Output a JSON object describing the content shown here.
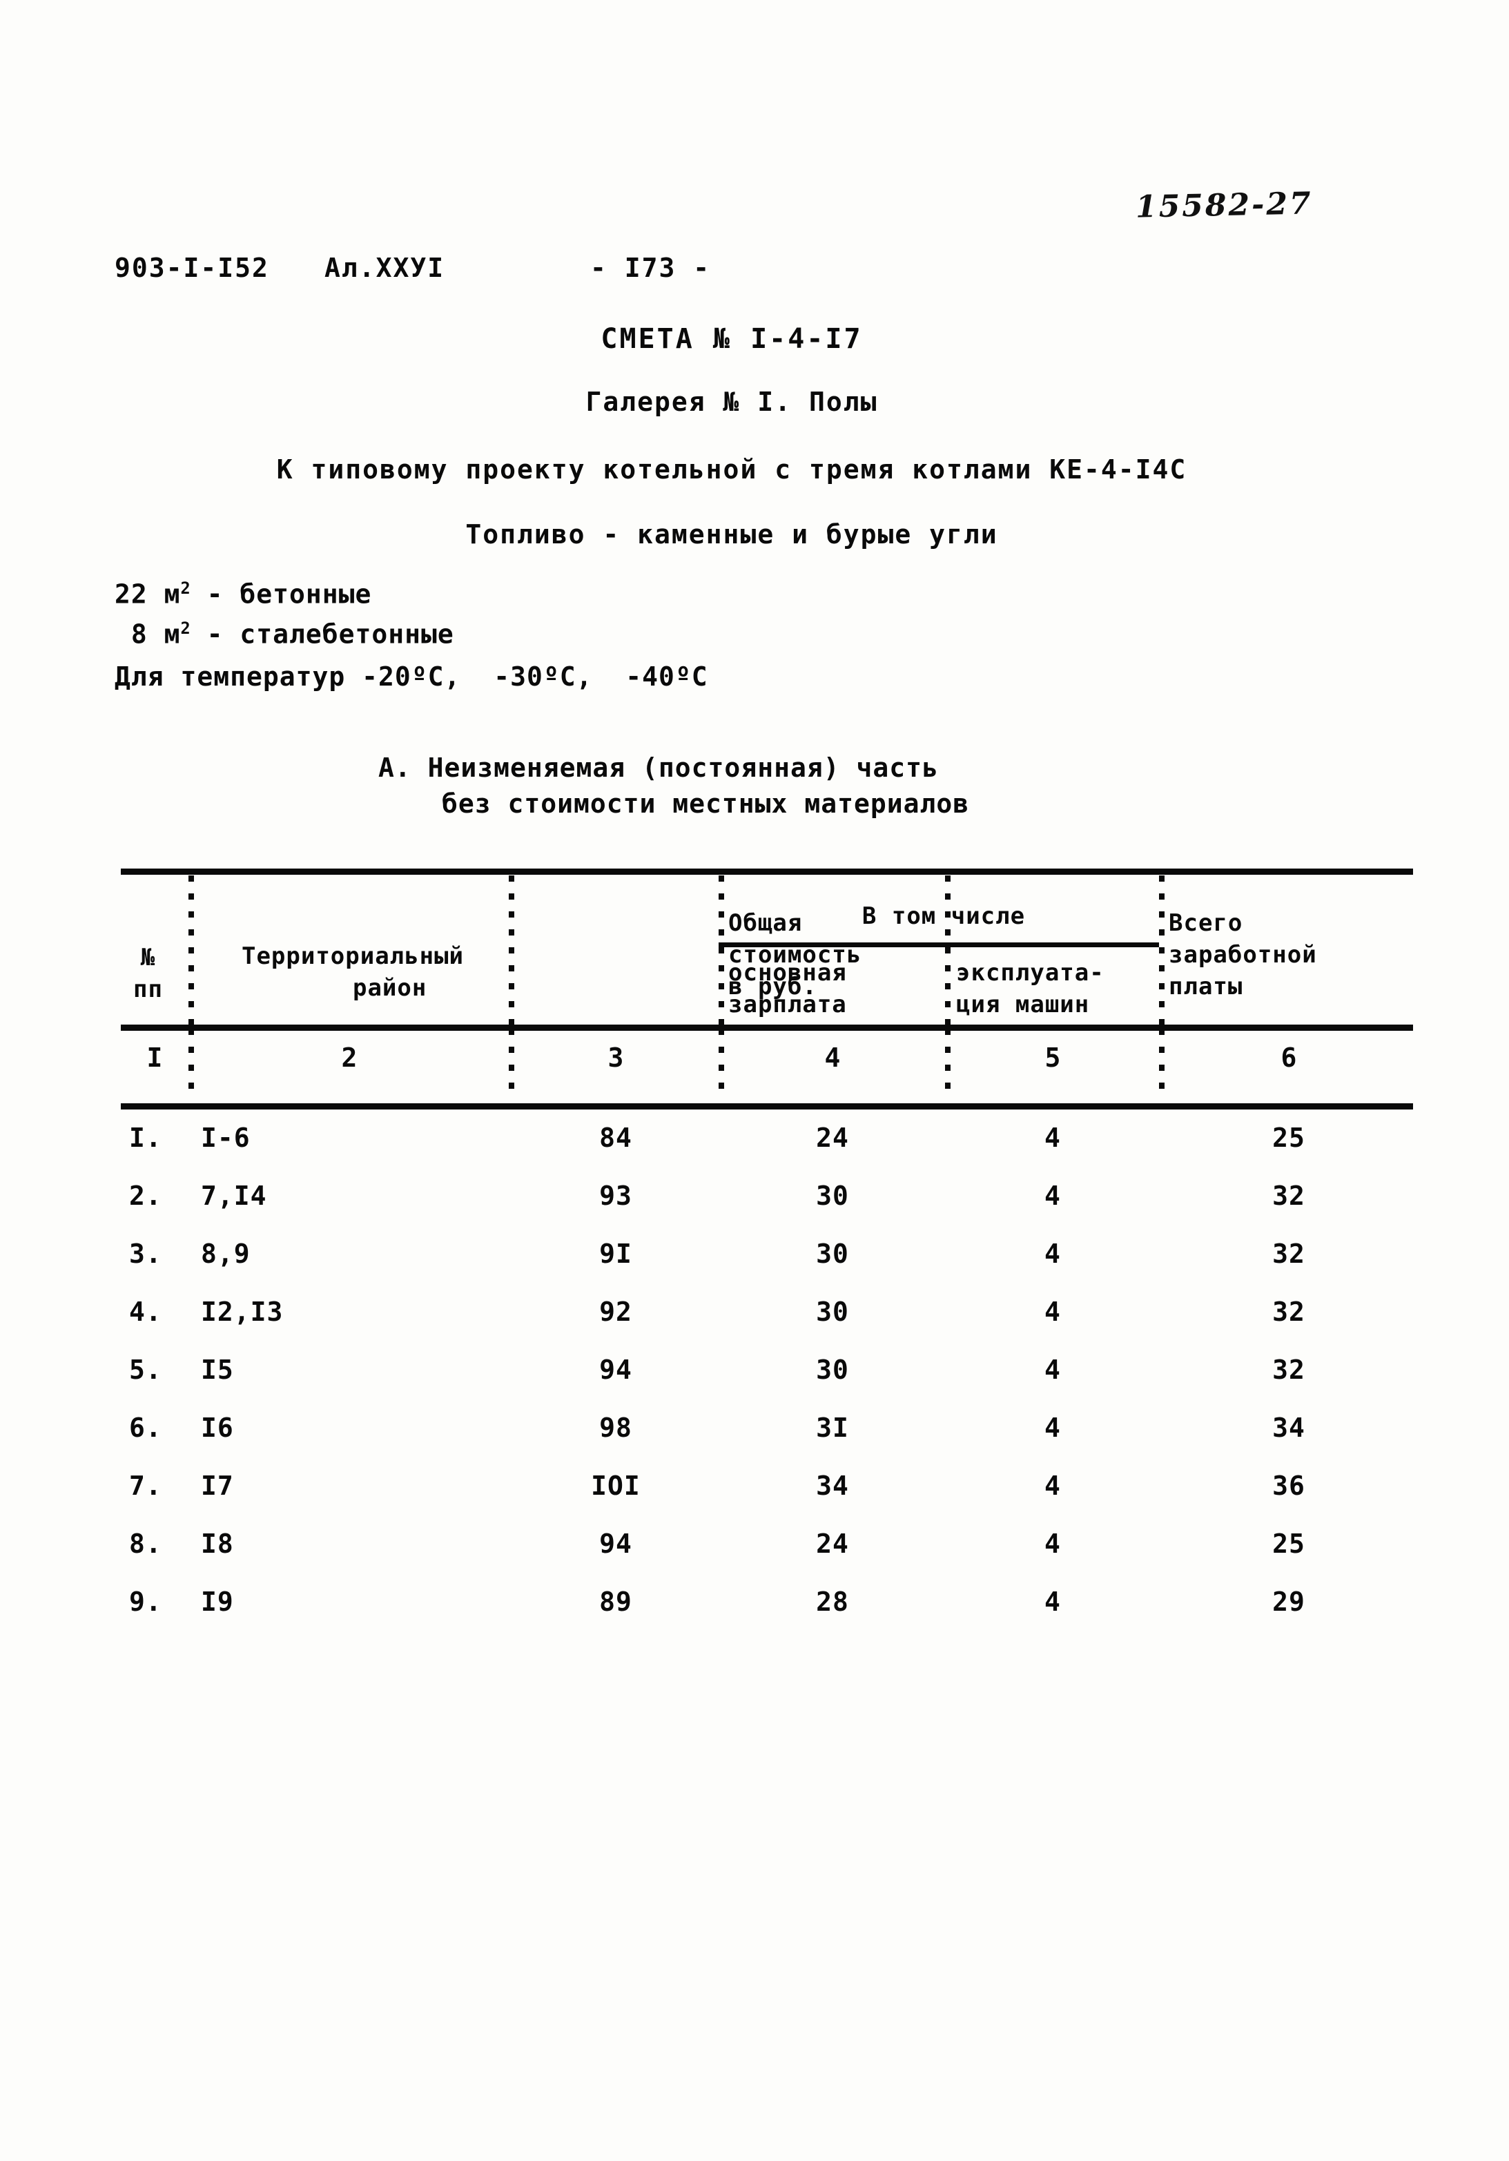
{
  "stamp": {
    "handwritten_number": "15582-27"
  },
  "header": {
    "doc_code": "903-I-I52",
    "album_code": "Ал.XXУI",
    "page_number": "- I73 -"
  },
  "titles": {
    "estimate": "СМЕТА № I-4-I7",
    "gallery": "Галерея № I. Полы",
    "project_ref": "К типовому проекту котельной с тремя котлами КЕ-4-I4С",
    "fuel": "Топливо - каменные и бурые угли"
  },
  "areas": {
    "concrete_value": "22",
    "concrete_unit": "м",
    "concrete_exp": "2",
    "concrete_label": " - бетонные",
    "steel_value": " 8",
    "steel_unit": "м",
    "steel_exp": "2",
    "steel_label": " - сталебетонные",
    "temperature": "Для температур -20ºС,  -30ºС,  -40ºС"
  },
  "section": {
    "line1": "А. Неизменяемая (постоянная) часть",
    "line2": "без стоимости местных материалов"
  },
  "table": {
    "headers": {
      "no": "№\nпп",
      "region": "Территориальный\n     район",
      "total_cost": "Общая\nстоимость\nв руб.",
      "group": "В том числе",
      "basic_wage": "основная\nзарплата",
      "machines": "эксплуата-\nция машин",
      "all_wages": "Всего\nзаработной\nплаты"
    },
    "column_numbers": [
      "I",
      "2",
      "3",
      "4",
      "5",
      "6"
    ],
    "rows": [
      {
        "idx": "I.",
        "region": "I-6",
        "total": "84",
        "basic": "24",
        "machines": "4",
        "wages": "25"
      },
      {
        "idx": "2.",
        "region": "7,I4",
        "total": "93",
        "basic": "30",
        "machines": "4",
        "wages": "32"
      },
      {
        "idx": "3.",
        "region": "8,9",
        "total": "9I",
        "basic": "30",
        "machines": "4",
        "wages": "32"
      },
      {
        "idx": "4.",
        "region": "I2,I3",
        "total": "92",
        "basic": "30",
        "machines": "4",
        "wages": "32"
      },
      {
        "idx": "5.",
        "region": "I5",
        "total": "94",
        "basic": "30",
        "machines": "4",
        "wages": "32"
      },
      {
        "idx": "6.",
        "region": "I6",
        "total": "98",
        "basic": "3I",
        "machines": "4",
        "wages": "34"
      },
      {
        "idx": "7.",
        "region": "I7",
        "total": "IOI",
        "basic": "34",
        "machines": "4",
        "wages": "36"
      },
      {
        "idx": "8.",
        "region": "I8",
        "total": "94",
        "basic": "24",
        "machines": "4",
        "wages": "25"
      },
      {
        "idx": "9.",
        "region": "I9",
        "total": "89",
        "basic": "28",
        "machines": "4",
        "wages": "29"
      }
    ]
  }
}
